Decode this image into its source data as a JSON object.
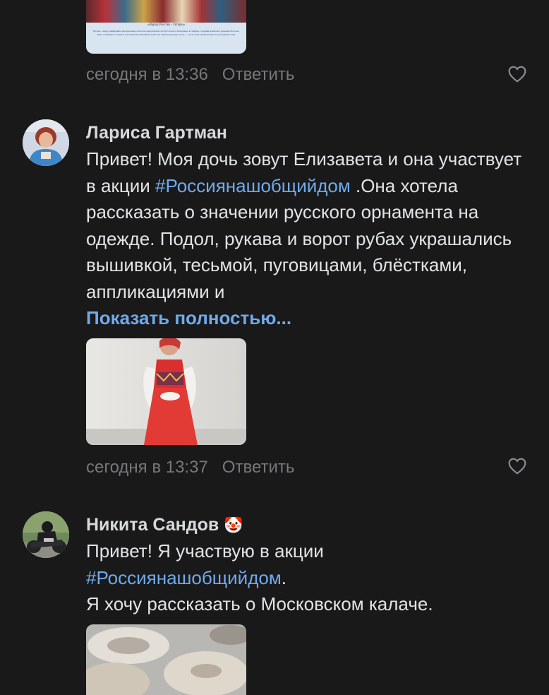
{
  "top_post": {
    "image_icon": "poster-image",
    "image_caption": "«Народ России - татары»",
    "image_text": "Татары - народ, живущий в центральных областях европейской части России, в Поволжье, в Сибири, Средней Азии и на Дальнем Востоке. Они составляют основное население Республики Татарстан. Язык и культура татар — часть многонационального наследия России.",
    "timestamp": "сегодня в 13:36",
    "reply_label": "Ответить",
    "like_icon": "heart-icon"
  },
  "comments": [
    {
      "author": "Лариса Гартман",
      "text_before": "Привет! Моя дочь зовут Елизавета и она участвует в акции ",
      "hashtag": "#Россиянашобщийдом",
      "text_after": " .Она хотела рассказать о значении русского орнамента на одежде. Подол, рукава и ворот рубах украшались вышивкой, тесьмой, пуговицами, блёстками, аппликациями и",
      "show_more": "Показать полностью...",
      "timestamp": "сегодня в 13:37",
      "reply_label": "Ответить",
      "like_icon": "heart-icon"
    },
    {
      "author": "Никита Сандов",
      "author_emoji": "🤡",
      "text_before": "Привет! Я участвую в акции",
      "hashtag": "#Россиянашобщийдом",
      "text_after": ".",
      "text_line3": "Я хочу рассказать о Московском калаче."
    }
  ],
  "colors": {
    "background": "#19191a",
    "text": "#e1e3e6",
    "secondary": "#76787a",
    "link": "#71aaeb"
  }
}
